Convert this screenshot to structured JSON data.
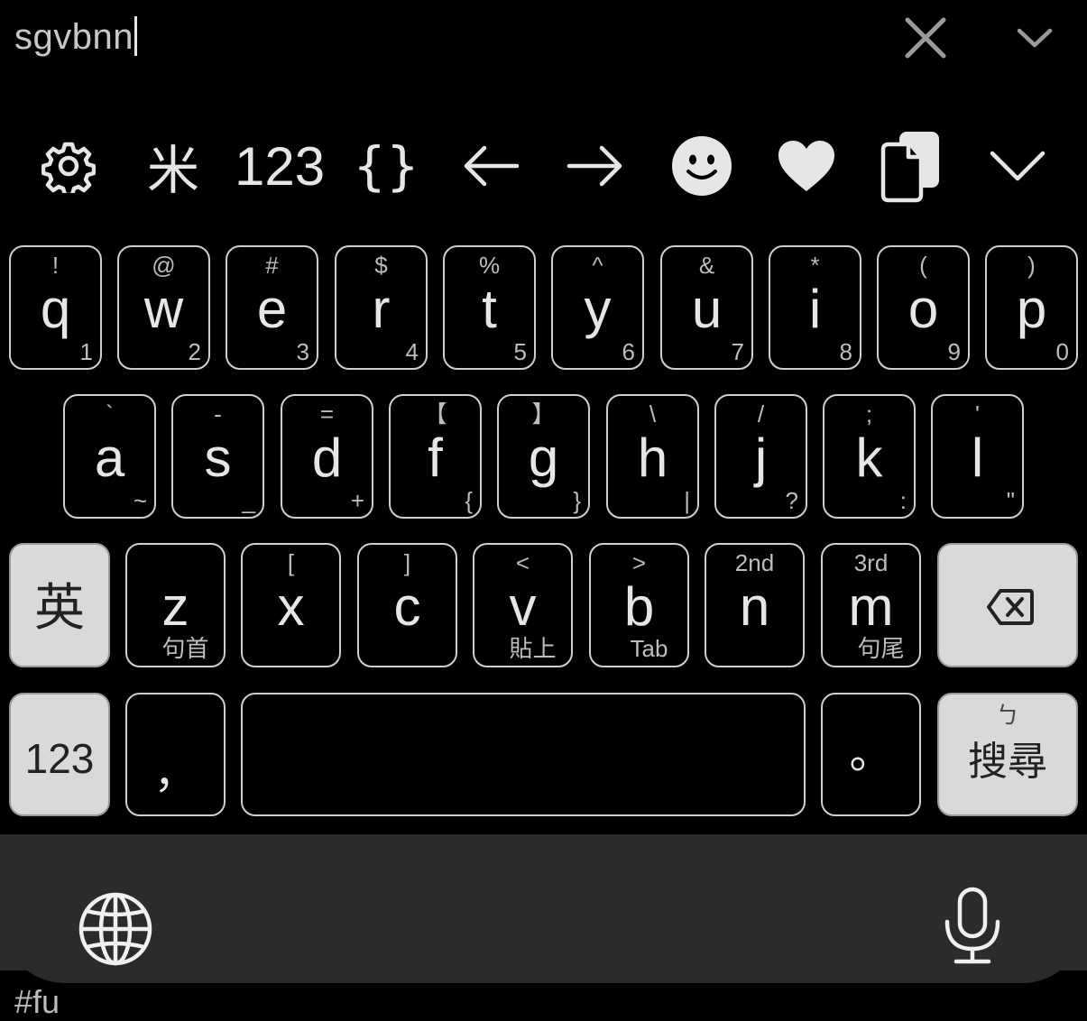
{
  "input": {
    "value": "sgvbnn"
  },
  "toolbar": {
    "symbol_key": "米",
    "number_key": "123",
    "braces_key": "{}",
    "left_arrow": "←",
    "right_arrow": "→"
  },
  "icons": {
    "clear": "close-icon",
    "collapse": "chevron-down-icon",
    "settings": "gear-icon",
    "emoji": "smiley-icon",
    "favorite": "heart-icon",
    "clipboard": "clipboard-icon",
    "backspace": "backspace-icon",
    "globe": "globe-icon",
    "mic": "microphone-icon"
  },
  "rows": {
    "row1": [
      {
        "main": "q",
        "top": "!",
        "corner": "1"
      },
      {
        "main": "w",
        "top": "@",
        "corner": "2"
      },
      {
        "main": "e",
        "top": "#",
        "corner": "3"
      },
      {
        "main": "r",
        "top": "$",
        "corner": "4"
      },
      {
        "main": "t",
        "top": "%",
        "corner": "5"
      },
      {
        "main": "y",
        "top": "^",
        "corner": "6"
      },
      {
        "main": "u",
        "top": "&",
        "corner": "7"
      },
      {
        "main": "i",
        "top": "*",
        "corner": "8"
      },
      {
        "main": "o",
        "top": "(",
        "corner": "9"
      },
      {
        "main": "p",
        "top": ")",
        "corner": "0"
      }
    ],
    "row2": [
      {
        "main": "a",
        "top": "`",
        "corner": "~"
      },
      {
        "main": "s",
        "top": "-",
        "corner": "_"
      },
      {
        "main": "d",
        "top": "=",
        "corner": "+"
      },
      {
        "main": "f",
        "top": "【",
        "corner": "{"
      },
      {
        "main": "g",
        "top": "】",
        "corner": "}"
      },
      {
        "main": "h",
        "top": "\\",
        "corner": "|"
      },
      {
        "main": "j",
        "top": "/",
        "corner": "?"
      },
      {
        "main": "k",
        "top": ";",
        "corner": ":"
      },
      {
        "main": "l",
        "top": "'",
        "corner": "\""
      }
    ],
    "row3": [
      {
        "main": "z",
        "top": "",
        "sub": "句首"
      },
      {
        "main": "x",
        "top": "[",
        "sub": ""
      },
      {
        "main": "c",
        "top": "]",
        "sub": ""
      },
      {
        "main": "v",
        "top": "<",
        "sub": "貼上"
      },
      {
        "main": "b",
        "top": ">",
        "sub": "Tab"
      },
      {
        "main": "n",
        "top": "2nd",
        "sub": ""
      },
      {
        "main": "m",
        "top": "3rd",
        "sub": "句尾"
      }
    ]
  },
  "keys": {
    "lang_toggle": "英",
    "numbers": "123",
    "comma": "，",
    "period": "。",
    "search_hint": "ㄅ",
    "search": "搜尋"
  },
  "peek_text": "#fu"
}
